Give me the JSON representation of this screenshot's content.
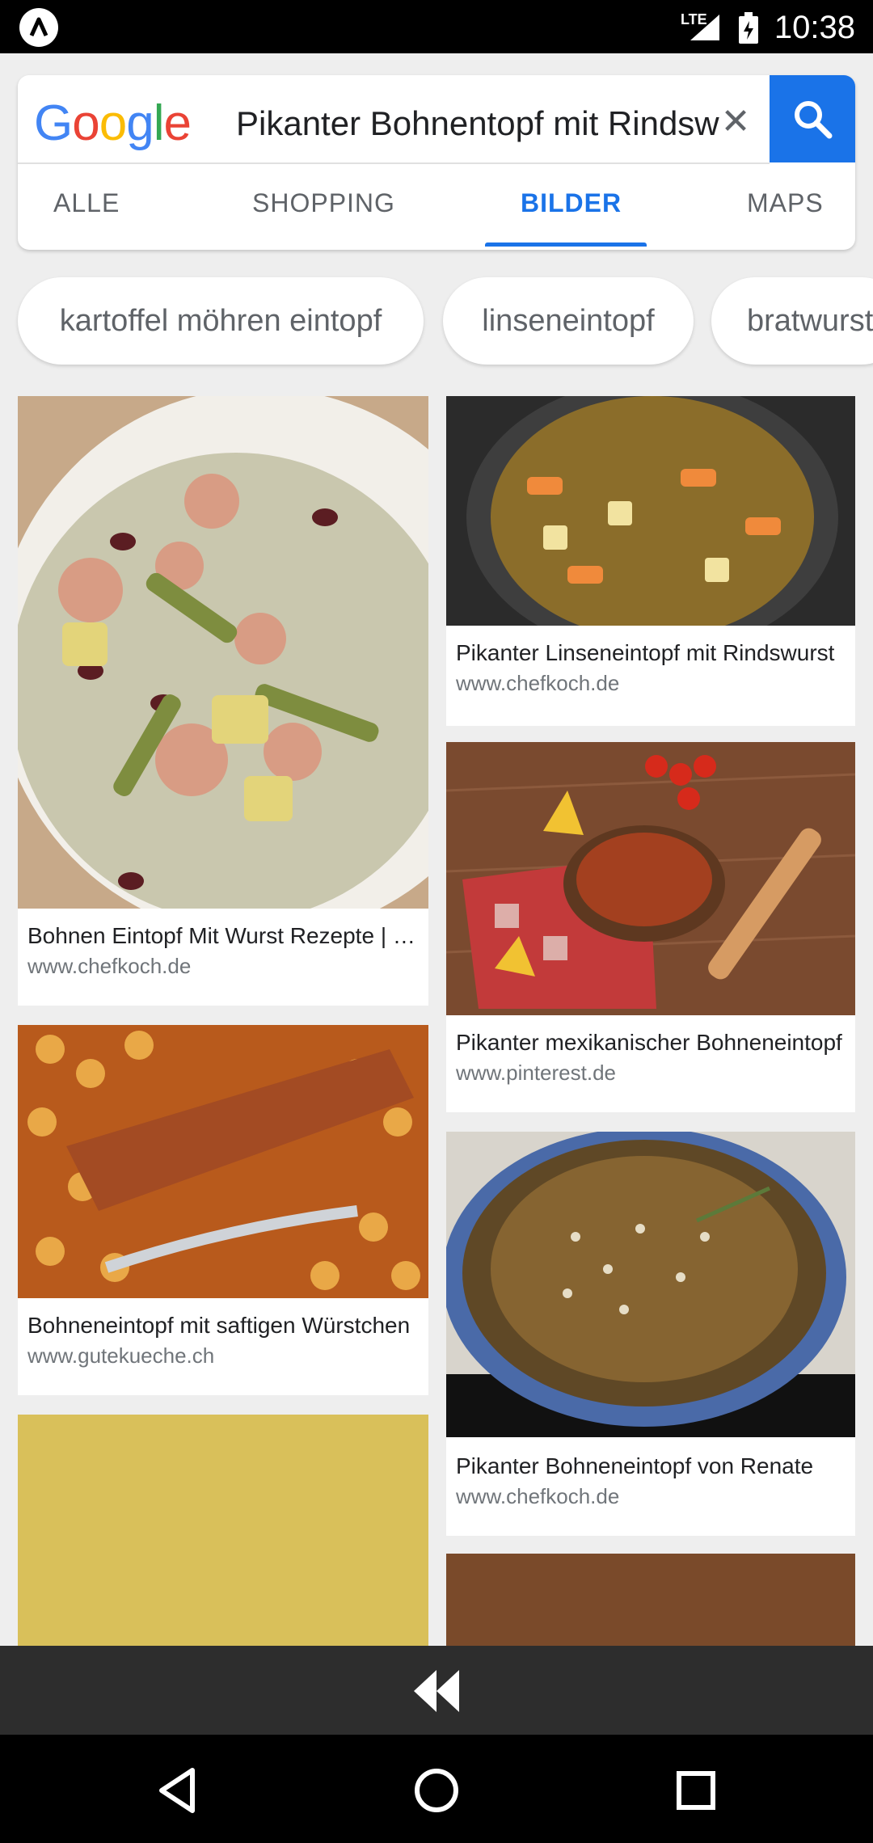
{
  "status_bar": {
    "time": "10:38",
    "network": "LTE",
    "colors": {
      "background": "#000000",
      "text": "#ffffff"
    }
  },
  "search": {
    "logo": "Google",
    "query": "Pikanter Bohnentopf mit Rindswurst",
    "clear_icon": "close-icon",
    "search_icon": "search-icon",
    "accent": "#1a73e8"
  },
  "tabs": [
    {
      "label": "ALLE"
    },
    {
      "label": "SHOPPING"
    },
    {
      "label": "BILDER",
      "active": true
    },
    {
      "label": "MAPS"
    }
  ],
  "chips": [
    {
      "label": "kartoffel möhren eintopf"
    },
    {
      "label": "linseneintopf"
    },
    {
      "label": "bratwurst"
    }
  ],
  "results": [
    {
      "title": "Bohnen Eintopf Mit Wurst Rezepte | Chefkoch",
      "site": "www.chefkoch.de",
      "image": "bean-stew-with-sausage"
    },
    {
      "title": "Pikanter Linseneintopf mit Rindswurst",
      "site": "www.chefkoch.de",
      "image": "lentil-stew-pot"
    },
    {
      "title": "Pikanter mexikanischer Bohneneintopf",
      "site": "www.pinterest.de",
      "image": "mexican-bean-stew"
    },
    {
      "title": "Bohneneintopf mit saftigen Würstchen",
      "site": "www.gutekueche.ch",
      "image": "baked-beans-sausage"
    },
    {
      "title": "Pikanter Bohneneintopf von Renate",
      "site": "www.chefkoch.de",
      "image": "bean-stew-dutch-oven"
    }
  ],
  "bottom": {
    "rewind_icon": "rewind-icon",
    "nav": [
      "back-icon",
      "home-icon",
      "recents-icon"
    ]
  }
}
